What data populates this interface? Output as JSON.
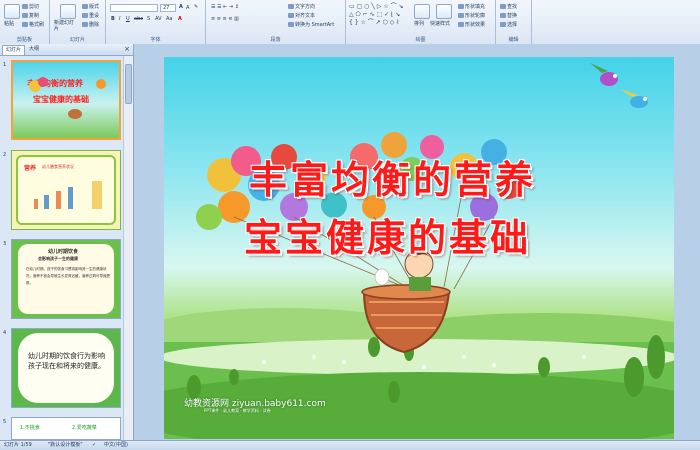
{
  "ribbon": {
    "clipboard": {
      "label": "剪贴板",
      "paste": "粘贴",
      "cut": "剪切",
      "copy": "复制",
      "format_painter": "格式刷"
    },
    "slides": {
      "label": "幻灯片",
      "new_slide": "新建幻灯片",
      "layout": "版式",
      "reset": "重设",
      "delete": "删除"
    },
    "font": {
      "label": "字体",
      "font_size": "27"
    },
    "paragraph": {
      "label": "段落",
      "text_direction": "文字方向",
      "align_text": "对齐文本",
      "convert_smartart": "转换为 SmartArt"
    },
    "drawing": {
      "label": "绘图",
      "arrange": "排列",
      "quick_styles": "快速样式",
      "shape_fill": "形状填充",
      "shape_outline": "形状轮廓",
      "shape_effects": "形状效果"
    },
    "editing": {
      "label": "编辑",
      "find": "查找",
      "replace": "替换",
      "select": "选择"
    }
  },
  "panel": {
    "tab_slides": "幻灯片",
    "tab_outline": "大纲",
    "close": "×",
    "thumbs": [
      {
        "num": "1",
        "line1": "丰富均衡的营养",
        "line2": "宝宝健康的基础"
      },
      {
        "num": "2",
        "heading": "营养",
        "sub": "幼儿膳食营养状况"
      },
      {
        "num": "3",
        "heading": "幼儿时期饮食",
        "sub": "会影响孩子一生的健康",
        "body": "在幼儿时期，孩子的饮食习惯将影响其一生的健康状况，营养不良会导致生长发育迟缓，营养过剩可导致肥胖。"
      },
      {
        "num": "4",
        "body": "幼儿时期的饮食行为影响孩子现在和将来的健康。"
      },
      {
        "num": "5",
        "a": "1.不挑食",
        "b": "2.爱吃蔬菜"
      }
    ]
  },
  "slide": {
    "title_line1": "丰富均衡的营养",
    "title_line2": "宝宝健康的基础",
    "watermark": "幼教资源网 ziyuan.baby611.com",
    "watermark_small": "PPT课件 · 幼儿教案 · 教学资料 · 试卷"
  },
  "status": {
    "slide_count": "幻灯片 1/59",
    "theme": "\"默认设计模板\"",
    "language": "中文(中国)"
  },
  "colors": {
    "title": "#ff1a1a",
    "selection": "#f2a33a",
    "ribbon": "#dbe6f4"
  }
}
